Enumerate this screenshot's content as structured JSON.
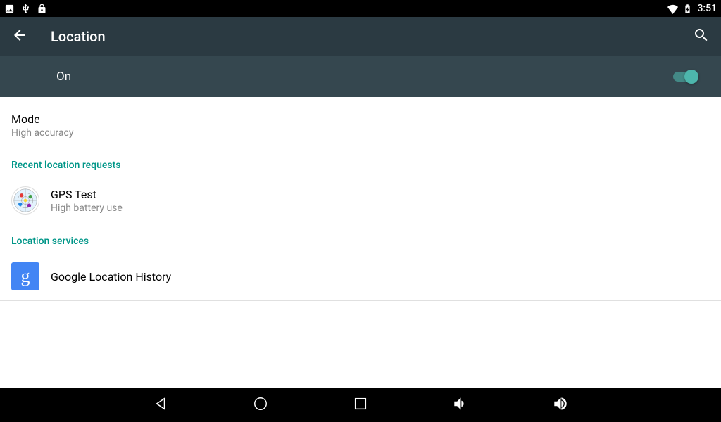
{
  "status": {
    "time": "3:51"
  },
  "appbar": {
    "title": "Location"
  },
  "toggle": {
    "state": "On",
    "on": true
  },
  "mode": {
    "title": "Mode",
    "sub": "High accuracy"
  },
  "sections": {
    "recent": "Recent location requests",
    "services": "Location services"
  },
  "recent_apps": [
    {
      "name": "GPS Test",
      "sub": "High battery use"
    }
  ],
  "services_items": [
    {
      "name": "Google Location History"
    }
  ]
}
